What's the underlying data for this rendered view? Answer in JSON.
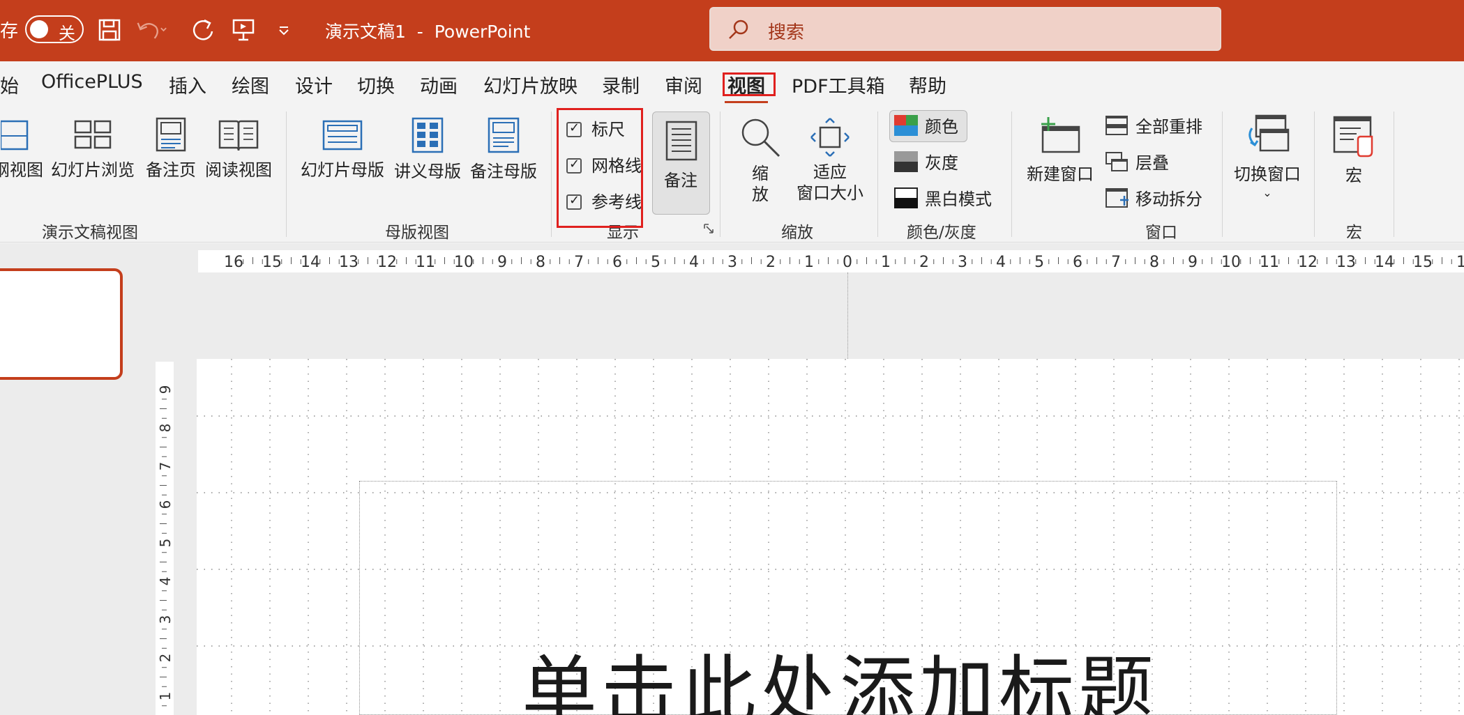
{
  "titlebar": {
    "autosave_label": "存",
    "autosave_state": "关",
    "document_title": "演示文稿1  -  PowerPoint",
    "search_placeholder": "搜索",
    "qa_icons": [
      "save-icon",
      "undo-icon",
      "redo-icon",
      "present-icon",
      "customize-icon"
    ]
  },
  "tabs": [
    {
      "label": "始"
    },
    {
      "label": "OfficePLUS"
    },
    {
      "label": "插入"
    },
    {
      "label": "绘图"
    },
    {
      "label": "设计"
    },
    {
      "label": "切换"
    },
    {
      "label": "动画"
    },
    {
      "label": "幻灯片放映"
    },
    {
      "label": "录制"
    },
    {
      "label": "审阅"
    },
    {
      "label": "视图",
      "active": true
    },
    {
      "label": "PDF工具箱"
    },
    {
      "label": "帮助"
    }
  ],
  "ribbon": {
    "presentation_views": {
      "label": "演示文稿视图",
      "buttons": [
        "纲视图",
        "幻灯片浏览",
        "备注页",
        "阅读视图"
      ]
    },
    "master_views": {
      "label": "母版视图",
      "buttons": [
        "幻灯片母版",
        "讲义母版",
        "备注母版"
      ]
    },
    "show": {
      "label": "显示",
      "checkboxes": [
        {
          "label": "标尺",
          "checked": true
        },
        {
          "label": "网格线",
          "checked": true
        },
        {
          "label": "参考线",
          "checked": true
        }
      ],
      "notes": "备注"
    },
    "zoom": {
      "label": "缩放",
      "zoom_btn": "缩\n放",
      "fit_btn_line1": "适应",
      "fit_btn_line2": "窗口大小"
    },
    "color": {
      "label": "颜色/灰度",
      "color": "颜色",
      "gray": "灰度",
      "bw": "黑白模式"
    },
    "window": {
      "label": "窗口",
      "new_window": "新建窗口",
      "arrange_all": "全部重排",
      "cascade": "层叠",
      "move_split": "移动拆分",
      "switch_window": "切换窗口"
    },
    "macros": {
      "label": "宏",
      "macro": "宏"
    }
  },
  "ruler": {
    "horizontal": [
      "16",
      "15",
      "14",
      "13",
      "12",
      "11",
      "10",
      "9",
      "8",
      "7",
      "6",
      "5",
      "4",
      "3",
      "2",
      "1",
      "0",
      "1",
      "2",
      "3",
      "4",
      "5",
      "6",
      "7",
      "8",
      "9",
      "10",
      "11",
      "12",
      "13",
      "14",
      "15",
      "1"
    ],
    "vertical": [
      "9",
      "8",
      "7",
      "6",
      "5",
      "4",
      "3",
      "2",
      "1"
    ]
  },
  "slide": {
    "title_placeholder": "单击此处添加标题"
  },
  "colors": {
    "accent": "#c43e1c",
    "highlight": "#e0201e"
  }
}
